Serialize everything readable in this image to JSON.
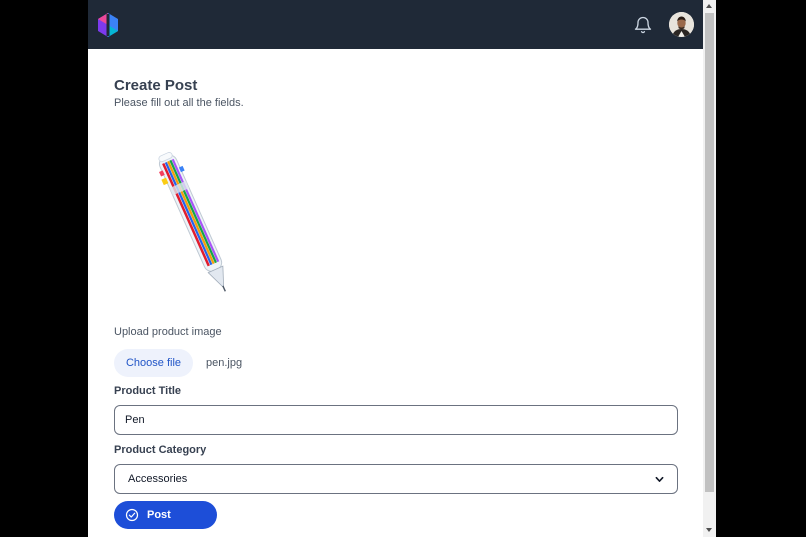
{
  "header": {
    "logo_icon": "logo-icon",
    "notification_icon": "bell-icon",
    "avatar_icon": "user-avatar"
  },
  "form": {
    "title": "Create Post",
    "subtitle": "Please fill out all the fields.",
    "image_preview_icon": "multicolor-pen-image",
    "upload_label": "Upload product image",
    "choose_file_label": "Choose file",
    "file_name": "pen.jpg",
    "product_title_label": "Product Title",
    "product_title_value": "Pen",
    "product_category_label": "Product Category",
    "product_category_value": "Accessories",
    "post_button_label": "Post",
    "post_button_icon": "check-circle-icon"
  },
  "colors": {
    "header_bg": "#1f2937",
    "primary": "#1d4ed8",
    "choose_file_bg": "#eef2fc",
    "choose_file_text": "#2155c7"
  }
}
